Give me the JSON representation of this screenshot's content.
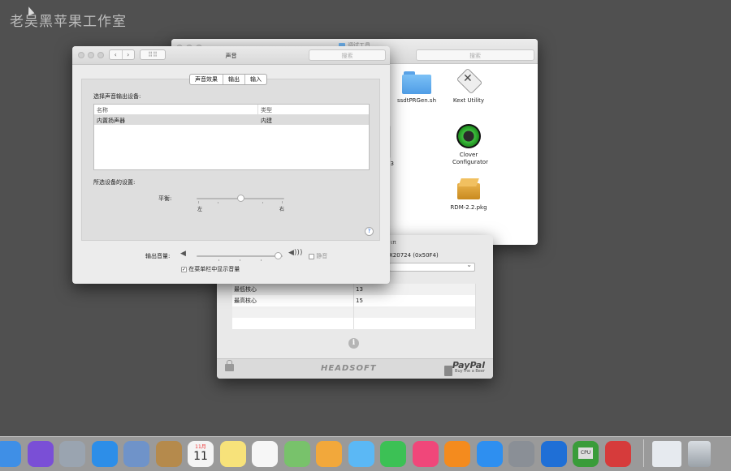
{
  "watermark": "老吴黑苹果工作室",
  "finder": {
    "title": "调试工具",
    "search_placeholder": "搜索",
    "items": [
      {
        "label": "ssdtPRGen.sh",
        "icon": "folder-icon"
      },
      {
        "label": "Kext Utility",
        "icon": "kext-utility-icon"
      },
      {
        "label": "Clover Configurator",
        "icon": "clover-icon"
      },
      {
        "label": "RDM-2.2.pkg",
        "icon": "package-icon"
      }
    ],
    "partial_label": "p3"
  },
  "cpu_window": {
    "partial_row1": "ιπ",
    "partial_row2": "X20724 (0x50F4)",
    "rows": [
      {
        "name": "最低核心",
        "value": "13"
      },
      {
        "name": "最高核心",
        "value": "15"
      },
      {
        "name": "",
        "value": ""
      },
      {
        "name": "",
        "value": ""
      }
    ],
    "brand": "HEADSOFT",
    "paypal": "PayPal",
    "paypal_sub": "Buy me a Beer"
  },
  "sound": {
    "title": "声音",
    "search_placeholder": "搜索",
    "tabs": [
      "声音效果",
      "输出",
      "输入"
    ],
    "selected_tab": "输出",
    "select_device_label": "选择声音输出设备:",
    "columns": [
      "名称",
      "类型"
    ],
    "devices": [
      {
        "name": "内置扬声器",
        "type": "内建"
      }
    ],
    "settings_label": "所选设备的设置:",
    "balance_label": "平衡:",
    "balance_left": "左",
    "balance_right": "右",
    "balance_value": 0.5,
    "output_volume_label": "输出音量:",
    "output_volume_value": 0.95,
    "mute_label": "静音",
    "mute_checked": false,
    "show_in_menubar_label": "在菜单栏中显示音量",
    "show_in_menubar_checked": true
  },
  "dock": {
    "apps": [
      {
        "name": "finder-icon",
        "color": "#3f8fe6"
      },
      {
        "name": "siri-icon",
        "color": "#7a4fd6"
      },
      {
        "name": "launchpad-icon",
        "color": "#9aa4b0"
      },
      {
        "name": "safari-icon",
        "color": "#2d8ee8"
      },
      {
        "name": "mail-icon",
        "color": "#6f93c9"
      },
      {
        "name": "contacts-icon",
        "color": "#b58a4c"
      },
      {
        "name": "calendar-icon",
        "color": "#f4f4f4"
      },
      {
        "name": "notes-icon",
        "color": "#f7e27a"
      },
      {
        "name": "reminders-icon",
        "color": "#f6f6f6"
      },
      {
        "name": "maps-icon",
        "color": "#78c26b"
      },
      {
        "name": "photos-icon",
        "color": "#f2a83b"
      },
      {
        "name": "messages-icon",
        "color": "#5bb8f5"
      },
      {
        "name": "facetime-icon",
        "color": "#3cc155"
      },
      {
        "name": "music-icon",
        "color": "#f0477a"
      },
      {
        "name": "books-icon",
        "color": "#f48b1e"
      },
      {
        "name": "app-store-icon",
        "color": "#2e8ff0"
      },
      {
        "name": "system-preferences-icon",
        "color": "#8a8f96"
      },
      {
        "name": "teamviewer-icon",
        "color": "#1f6fd6"
      },
      {
        "name": "cpu-app-icon",
        "color": "#3a9c3a"
      },
      {
        "name": "ipv6-tool-icon",
        "color": "#d63b3b"
      }
    ],
    "calendar_month": "11月",
    "calendar_day": "11",
    "cpu_label": "CPU"
  }
}
